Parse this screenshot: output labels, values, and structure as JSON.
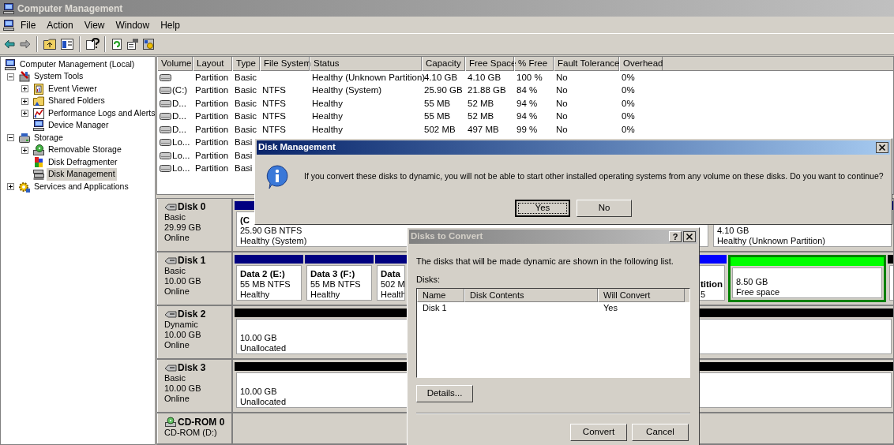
{
  "window": {
    "title": "Computer Management"
  },
  "menu": [
    "File",
    "Action",
    "View",
    "Window",
    "Help"
  ],
  "tree": {
    "label": "Computer Management (Local)",
    "selected": false,
    "children": [
      {
        "label": "System Tools",
        "expanded": true,
        "selected": false,
        "children": [
          {
            "label": "Event Viewer",
            "expanded": false,
            "selected": false
          },
          {
            "label": "Shared Folders",
            "expanded": false,
            "selected": false
          },
          {
            "label": "Performance Logs and Alerts",
            "expanded": false,
            "selected": false
          },
          {
            "label": "Device Manager",
            "selected": false
          }
        ]
      },
      {
        "label": "Storage",
        "expanded": true,
        "selected": false,
        "children": [
          {
            "label": "Removable Storage",
            "expanded": false,
            "selected": false
          },
          {
            "label": "Disk Defragmenter",
            "selected": false
          },
          {
            "label": "Disk Management",
            "selected": true
          }
        ]
      },
      {
        "label": "Services and Applications",
        "expanded": false,
        "selected": false
      }
    ]
  },
  "volumes": {
    "columns": [
      "Volume",
      "Layout",
      "Type",
      "File System",
      "Status",
      "Capacity",
      "Free Space",
      "% Free",
      "Fault Tolerance",
      "Overhead"
    ],
    "rows": [
      {
        "layout": "Partition",
        "type": "Basic",
        "status": "Healthy (Unknown Partition)",
        "capacity": "4.10 GB",
        "free_space": "4.10 GB",
        "pct_free": "100 %",
        "fault_tolerance": "No",
        "overhead": "0%"
      },
      {
        "volume": "(C:)",
        "layout": "Partition",
        "type": "Basic",
        "file_system": "NTFS",
        "status": "Healthy (System)",
        "capacity": "25.90 GB",
        "free_space": "21.88 GB",
        "pct_free": "84 %",
        "fault_tolerance": "No",
        "overhead": "0%"
      },
      {
        "volume": "D...",
        "layout": "Partition",
        "type": "Basic",
        "file_system": "NTFS",
        "status": "Healthy",
        "capacity": "55 MB",
        "free_space": "52 MB",
        "pct_free": "94 %",
        "fault_tolerance": "No",
        "overhead": "0%"
      },
      {
        "volume": "D...",
        "layout": "Partition",
        "type": "Basic",
        "file_system": "NTFS",
        "status": "Healthy",
        "capacity": "55 MB",
        "free_space": "52 MB",
        "pct_free": "94 %",
        "fault_tolerance": "No",
        "overhead": "0%"
      },
      {
        "volume": "D...",
        "layout": "Partition",
        "type": "Basic",
        "file_system": "NTFS",
        "status": "Healthy",
        "capacity": "502 MB",
        "free_space": "497 MB",
        "pct_free": "99 %",
        "fault_tolerance": "No",
        "overhead": "0%"
      },
      {
        "volume": "Lo...",
        "layout": "Partition",
        "type": "Basi"
      },
      {
        "volume": "Lo...",
        "layout": "Partition",
        "type": "Basi"
      },
      {
        "volume": "Lo...",
        "layout": "Partition",
        "type": "Basi"
      }
    ]
  },
  "disks": [
    {
      "kind": "disk",
      "name": "Disk 0",
      "type": "Basic",
      "size": "29.99 GB",
      "status": "Online",
      "partitions": [
        {
          "kind": "primary",
          "title": "(C",
          "size": "25.90 GB NTFS",
          "status": "Healthy (System)"
        },
        {
          "kind": "primary",
          "size": "4.10 GB",
          "status": "Healthy (Unknown Partition)"
        }
      ]
    },
    {
      "kind": "disk",
      "name": "Disk 1",
      "type": "Basic",
      "size": "10.00 GB",
      "status": "Online",
      "partitions": [
        {
          "kind": "primary",
          "title": "Data 2 (E:)",
          "size": "55 MB NTFS",
          "status": "Healthy"
        },
        {
          "kind": "primary",
          "title": "Data 3 (F:)",
          "size": "55 MB NTFS",
          "status": "Healthy"
        },
        {
          "kind": "primary",
          "title": "Data",
          "size": "502 M",
          "status": "Health"
        },
        {
          "kind": "logical",
          "title": "tition",
          "size": "5"
        },
        {
          "kind": "free",
          "size": "8.50 GB",
          "status": "Free space"
        },
        {
          "kind": "unallocated"
        }
      ]
    },
    {
      "kind": "disk",
      "name": "Disk 2",
      "type": "Dynamic",
      "size": "10.00 GB",
      "status": "Online",
      "partitions": [
        {
          "kind": "unallocated",
          "size": "10.00 GB",
          "status": "Unallocated"
        }
      ]
    },
    {
      "kind": "disk",
      "name": "Disk 3",
      "type": "Basic",
      "size": "10.00 GB",
      "status": "Online",
      "partitions": [
        {
          "kind": "unallocated",
          "size": "10.00 GB",
          "status": "Unallocated"
        }
      ]
    },
    {
      "kind": "cdrom",
      "name": "CD-ROM 0",
      "type": "CD-ROM (D:)"
    }
  ],
  "confirm_dialog": {
    "title": "Disk Management",
    "active": true,
    "message": "If you convert these disks to dynamic, you will not be able to start other installed operating systems from any volume on these disks. Do you want to continue?",
    "buttons": [
      {
        "label": "Yes",
        "default": true
      },
      {
        "label": "No",
        "default": false
      }
    ]
  },
  "convert_dialog": {
    "title": "Disks to Convert",
    "active": false,
    "help_button": "?",
    "intro": "The disks that will be made dynamic are shown in the following list.",
    "list_label": "Disks:",
    "columns": [
      "Name",
      "Disk Contents",
      "Will Convert"
    ],
    "rows": [
      {
        "name": "Disk 1",
        "will_convert": "Yes"
      }
    ],
    "details_button": "Details...",
    "buttons": [
      {
        "label": "Convert",
        "default": false
      },
      {
        "label": "Cancel",
        "default": false
      }
    ]
  }
}
